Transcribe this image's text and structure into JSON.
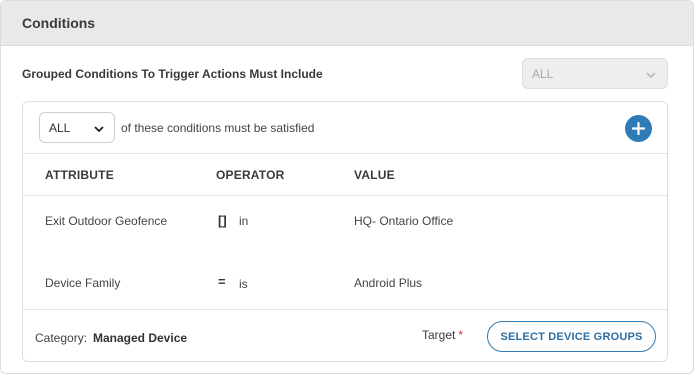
{
  "panel": {
    "title": "Conditions"
  },
  "group": {
    "label": "Grouped Conditions To Trigger Actions Must Include",
    "select_value": "ALL"
  },
  "conditions": {
    "match_select_value": "ALL",
    "satisfied_text": "of these conditions must be satisfied",
    "add_button_icon": "plus-icon",
    "columns": {
      "attribute": "ATTRIBUTE",
      "operator": "OPERATOR",
      "value": "VALUE"
    },
    "rows": [
      {
        "attribute": "Exit Outdoor Geofence",
        "operator_symbol": "[]",
        "operator_text": "in",
        "value": "HQ- Ontario Office"
      },
      {
        "attribute": "Device Family",
        "operator_symbol": "=",
        "operator_text": "is",
        "value": "Android Plus"
      }
    ]
  },
  "footer": {
    "category_label": "Category:",
    "category_value": "Managed Device",
    "target_label": "Target",
    "required_mark": "*",
    "select_groups_label": "SELECT DEVICE GROUPS"
  },
  "colors": {
    "accent": "#2e7bb6",
    "required": "#d9263c",
    "header_bg": "#e9e9e9"
  }
}
